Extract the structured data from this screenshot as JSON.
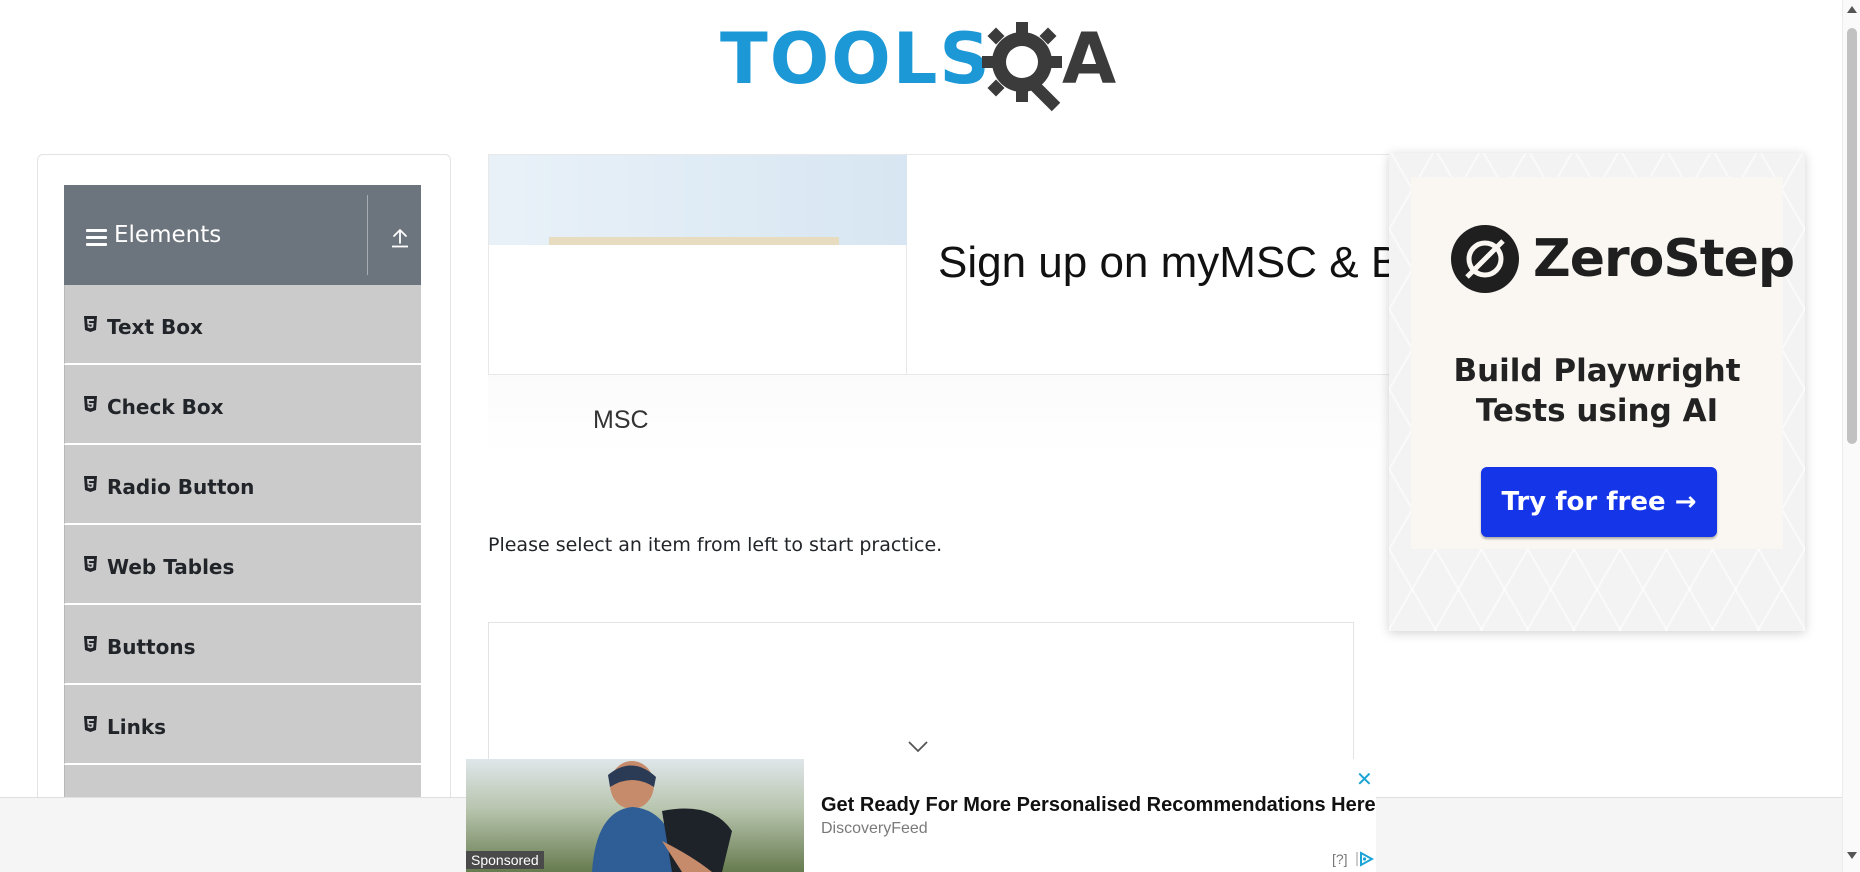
{
  "header": {
    "logo_part1": "TOOLS",
    "logo_part2": "A"
  },
  "sidebar": {
    "group_title": "Elements",
    "items": [
      {
        "label": "Text Box"
      },
      {
        "label": "Check Box"
      },
      {
        "label": "Radio Button"
      },
      {
        "label": "Web Tables"
      },
      {
        "label": "Buttons"
      },
      {
        "label": "Links"
      }
    ]
  },
  "banner_ad": {
    "headline": "Sign up on myMSC & B",
    "advertiser": "MSC"
  },
  "main": {
    "instruction": "Please select an item from left to start practice."
  },
  "right_ad": {
    "brand": "ZeroStep",
    "tagline_line1": "Build Playwright",
    "tagline_line2": "Tests using AI",
    "cta": "Try for free →",
    "cta_color": "#1535e8"
  },
  "bottom_ad": {
    "sponsored_label": "Sponsored",
    "headline": "Get Ready For More Personalised Recommendations Here",
    "source": "DiscoveryFeed",
    "close_symbol": "✕",
    "adchoices_label": "[?]"
  },
  "colors": {
    "brand_blue": "#1b98d5",
    "sidebar_header": "#6c757d",
    "menu_item_bg": "#cbcbcb"
  }
}
